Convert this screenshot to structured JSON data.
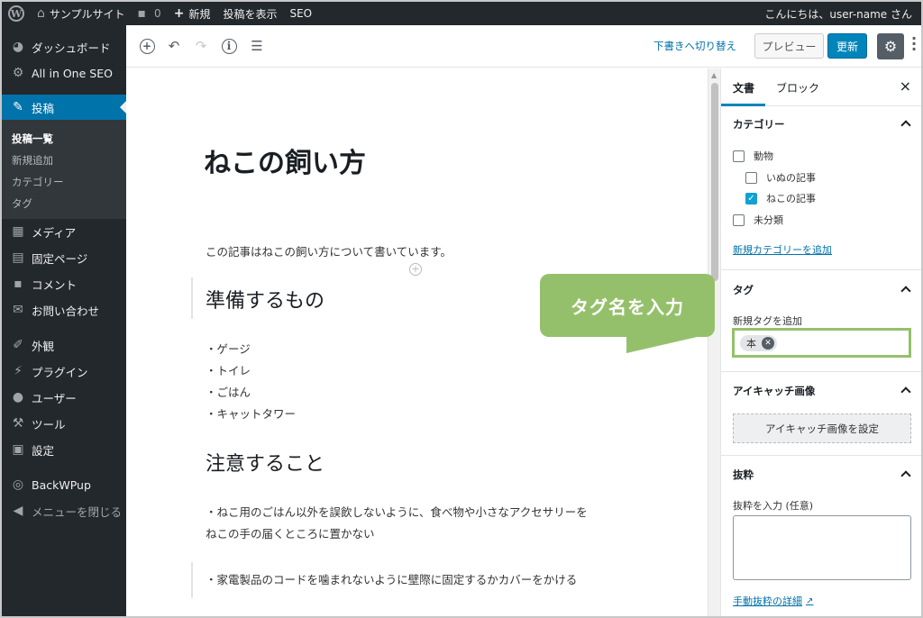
{
  "admin_bar": {
    "wp_logo": "W",
    "site_name": "サンプルサイト",
    "comments_count": "0",
    "new_label": "新規",
    "view_post": "投稿を表示",
    "seo": "SEO",
    "greeting": "こんにちは、user-name さん"
  },
  "sidebar": {
    "dashboard": "ダッシュボード",
    "aioseo": "All in One SEO",
    "posts": "投稿",
    "posts_sub": {
      "all_posts": "投稿一覧",
      "add_new": "新規追加",
      "categories": "カテゴリー",
      "tags": "タグ"
    },
    "media": "メディア",
    "pages": "固定ページ",
    "comments": "コメント",
    "contact": "お問い合わせ",
    "appearance": "外観",
    "plugins": "プラグイン",
    "users": "ユーザー",
    "tools": "ツール",
    "settings": "設定",
    "backwpup": "BackWPup",
    "collapse": "メニューを閉じる"
  },
  "toolbar": {
    "switch_to_draft": "下書きへ切り替え",
    "preview": "プレビュー",
    "update": "更新"
  },
  "editor": {
    "title": "ねこの飼い方",
    "intro": "この記事はねこの飼い方について書いています。",
    "heading1": "準備するもの",
    "list": [
      "・ゲージ",
      "・トイレ",
      "・ごはん",
      "・キャットタワー"
    ],
    "heading2": "注意すること",
    "caution1_line1": "・ねこ用のごはん以外を誤飲しないように、食べ物や小さなアクセサリーを",
    "caution1_line2": "ねこの手の届くところに置かない",
    "caution2": "・家電製品のコードを噛まれないように壁際に固定するかカバーをかける"
  },
  "settings_sidebar": {
    "tab_document": "文書",
    "tab_block": "ブロック",
    "close": "×",
    "categories_title": "カテゴリー",
    "categories": [
      {
        "label": "動物",
        "checked": false
      },
      {
        "label": "いぬの記事",
        "checked": false
      },
      {
        "label": "ねこの記事",
        "checked": true
      },
      {
        "label": "未分類",
        "checked": false
      }
    ],
    "add_category_link": "新規カテゴリーを追加",
    "tags_title": "タグ",
    "add_tag_label": "新規タグを追加",
    "tag_token": "本",
    "featured_title": "アイキャッチ画像",
    "set_featured": "アイキャッチ画像を設定",
    "excerpt_title": "抜粋",
    "excerpt_label": "抜粋を入力 (任意)",
    "excerpt_value": "",
    "excerpt_help_link": "手動抜粋の詳細"
  },
  "callout": {
    "text": "タグ名を入力"
  },
  "colors": {
    "admin_dark": "#23282d",
    "admin_blue": "#0073aa",
    "callout_green": "#95c06b",
    "update_button": "#0085ba"
  },
  "icons": [
    "wordpress-logo-icon",
    "home-icon",
    "comment-icon",
    "plus-icon",
    "dashboard-icon",
    "gear-icon",
    "pushpin-icon",
    "media-icon",
    "page-icon",
    "comment-bubble-icon",
    "mail-icon",
    "brush-icon",
    "plugin-icon",
    "user-icon",
    "wrench-icon",
    "settings-icon",
    "backup-icon",
    "collapse-icon",
    "add-block-icon",
    "undo-icon",
    "redo-icon",
    "info-icon",
    "outline-icon",
    "more-vertical-icon",
    "close-icon",
    "chevron-up-icon",
    "external-link-icon"
  ]
}
